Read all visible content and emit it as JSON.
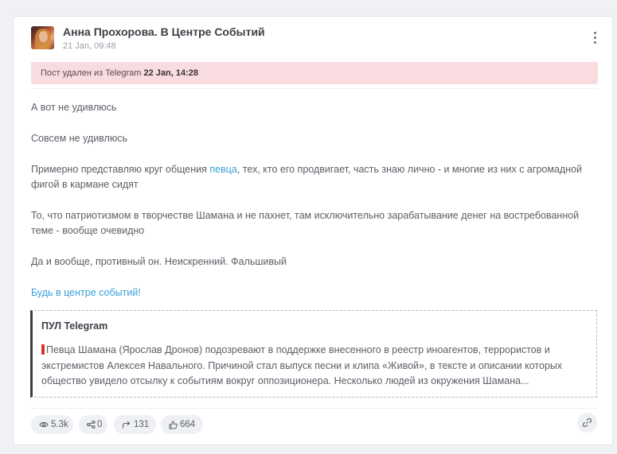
{
  "post": {
    "channel_name": "Анна Прохорова. В Центре Событий",
    "date": "21 Jan, 09:48",
    "deleted_notice": {
      "text": "Пост удален из Telegram",
      "date": "22 Jan, 14:28"
    },
    "paragraphs": [
      "А вот не удивлюсь",
      "Совсем не удивлюсь"
    ],
    "paragraph3": {
      "before": "Примерно представляю круг общения ",
      "link": "певца",
      "after": ", тех, кто его продвигает, часть знаю лично - и многие из них с агромадной фигой в кармане сидят"
    },
    "paragraph4": "То, что патриотизмом в творчестве Шамана и не пахнет, там исключительно зарабатывание денег на востребованной теме - вообще очевидно",
    "paragraph5": "Да и вообще, противный он. Неискренний. Фальшивый",
    "footer_link": "Будь в центре событий!",
    "quote": {
      "title": "ПУЛ Telegram",
      "text": "Певца Шамана (Ярослав Дронов) подозревают в поддержке внесенного в реестр иноагентов, террористов и экстремистов Алексея Навального. Причиной стал выпуск песни и клипа «Живой», в тексте и описании которых общество увидело отсылку к событиям вокруг оппозиционера. Несколько людей из окружения Шамана..."
    },
    "stats": {
      "views": "5.3k",
      "shares": "0",
      "forwards": "131",
      "reactions": "664"
    }
  },
  "icons": {
    "views": "eye-icon",
    "shares": "share-icon",
    "forwards": "forward-arrow-icon",
    "reactions": "thumbs-up-icon",
    "copy_link": "link-icon",
    "menu": "kebab-menu-icon"
  },
  "colors": {
    "link": "#3aa1d8",
    "deleted_banner_bg": "#f8dcdf",
    "card_bg": "#ffffff",
    "page_bg": "#f0f1f4"
  }
}
